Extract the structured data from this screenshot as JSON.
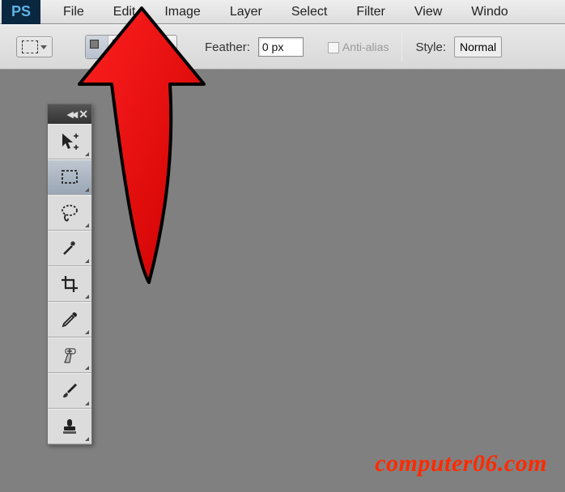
{
  "menubar": {
    "logo": "PS",
    "items": [
      "File",
      "Edit",
      "Image",
      "Layer",
      "Select",
      "Filter",
      "View",
      "Windo"
    ]
  },
  "optionsbar": {
    "feather_label": "Feather:",
    "feather_value": "0 px",
    "antialias_label": "Anti-alias",
    "style_label": "Style:",
    "style_value": "Normal"
  },
  "tools": [
    {
      "name": "move-tool"
    },
    {
      "name": "marquee-tool",
      "active": true
    },
    {
      "name": "lasso-tool"
    },
    {
      "name": "magic-wand-tool"
    },
    {
      "name": "crop-tool"
    },
    {
      "name": "eyedropper-tool"
    },
    {
      "name": "healing-brush-tool"
    },
    {
      "name": "brush-tool"
    },
    {
      "name": "stamp-tool"
    }
  ],
  "watermark": "computer06.com"
}
